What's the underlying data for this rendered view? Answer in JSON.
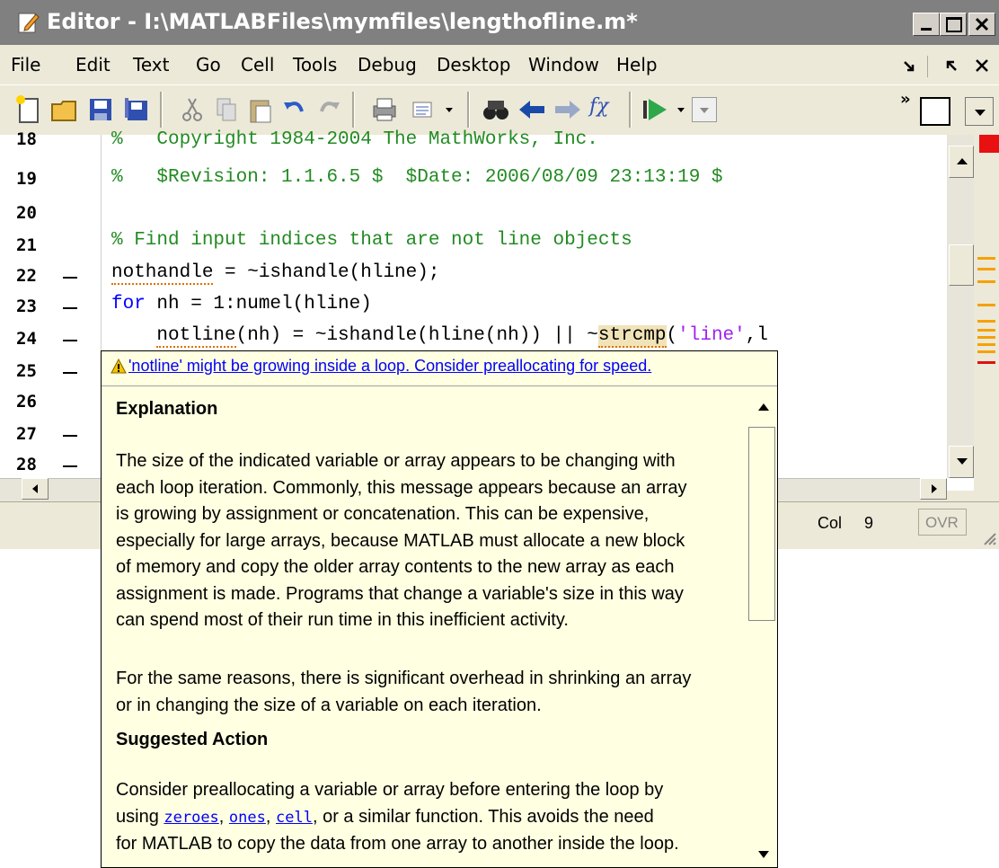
{
  "window": {
    "title": "Editor - I:\\MATLABFiles\\mymfiles\\lengthofline.m*"
  },
  "menubar": {
    "items": [
      "File",
      "Edit",
      "Text",
      "Go",
      "Cell",
      "Tools",
      "Debug",
      "Desktop",
      "Window",
      "Help"
    ]
  },
  "toolbar": {
    "fx_label": "fχ"
  },
  "editor": {
    "line_numbers": [
      "18",
      "19",
      "20",
      "21",
      "22",
      "23",
      "24",
      "25",
      "26",
      "27",
      "28"
    ],
    "line18": "%   Copyright 1984-2004 The MathWorks, Inc.",
    "line19": "%   $Revision: 1.1.6.5 $  $Date: 2006/08/09 23:13:19 $",
    "line21": "% Find input indices that are not line objects",
    "line22_var": "nothandle",
    "line22_rest": " = ~ishandle(hline);",
    "line23_kw": "for",
    "line23_rest": " nh = 1:numel(hline)",
    "line24_indent": "    ",
    "line24_var": "notline",
    "line24_mid": "(nh) = ~ishandle(hline(nh)) || ~",
    "line24_func": "strcmp",
    "line24_paren": "(",
    "line24_str": "'line'",
    "line24_end": ",l"
  },
  "status": {
    "col_label": "Col",
    "col_value": "9",
    "ovr": "OVR"
  },
  "tooltip": {
    "message": "'notline' might be growing inside a loop. Consider preallocating for speed.",
    "explanation_heading": "Explanation",
    "explanation_lines": [
      "The size of the indicated variable or array appears to be changing with",
      "each loop iteration. Commonly, this message appears because an array",
      "is growing by assignment or concatenation. This can be expensive,",
      "especially for large arrays, because MATLAB must allocate a new block",
      "of memory and copy the older array contents to the new array as each",
      "assignment is made. Programs that change a variable's size in this way",
      "can spend most of their run time in this inefficient activity."
    ],
    "overhead_lines": [
      "For the same reasons, there is significant overhead in shrinking an array",
      "or in changing the size of a variable on each iteration."
    ],
    "suggested_heading": "Suggested Action",
    "action_line1": "Consider preallocating a variable or array before entering the loop by",
    "action_using": "using ",
    "link_zeroes": "zeroes",
    "sep1": ", ",
    "link_ones": "ones",
    "sep2": ", ",
    "link_cell": "cell",
    "action_line2_end": ", or a similar function. This avoids the need",
    "action_line3": "for MATLAB to copy the data from one array to another inside the loop."
  }
}
